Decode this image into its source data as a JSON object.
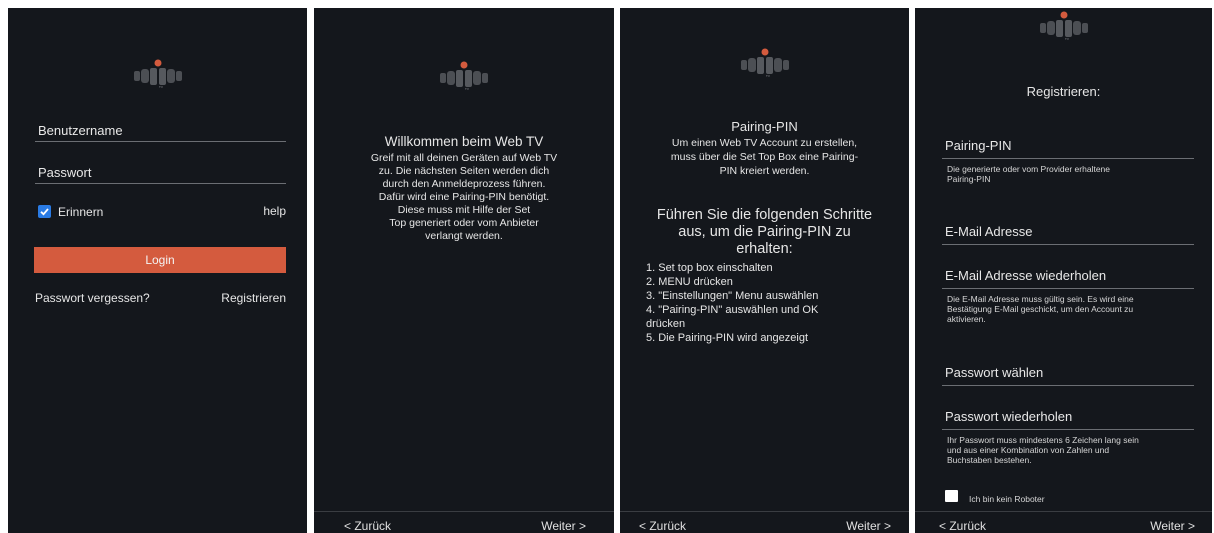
{
  "colors": {
    "panel_bg": "#14171c",
    "accent": "#d45b3e",
    "checkbox": "#2a7be4"
  },
  "login": {
    "username_label": "Benutzername",
    "password_label": "Passwort",
    "remember_label": "Erinnern",
    "remember_checked": true,
    "help_link": "help",
    "login_button": "Login",
    "forgot_link": "Passwort vergessen?",
    "register_link": "Registrieren"
  },
  "welcome": {
    "title": "Willkommen beim Web TV",
    "body_lines": [
      "Greif mit all deinen Geräten auf Web TV",
      "zu. Die nächsten Seiten werden dich",
      "durch den Anmeldeprozess führen.",
      "Dafür wird eine Pairing-PIN benötigt.",
      "Diese muss mit Hilfe der Set",
      "Top generiert oder vom Anbieter",
      "verlangt werden."
    ],
    "back": "< Zurück",
    "next": "Weiter >"
  },
  "pairing": {
    "title": "Pairing-PIN",
    "intro_lines": [
      "Um einen Web TV Account zu erstellen,",
      "muss über die Set Top Box eine Pairing-",
      "PIN kreiert werden."
    ],
    "steps_heading_lines": [
      "Führen Sie die folgenden Schritte",
      "aus, um die Pairing-PIN zu",
      "erhalten:"
    ],
    "steps": [
      "1. Set top box einschalten",
      "2. MENU drücken",
      "3. \"Einstellungen\" Menu auswählen",
      "4. \"Pairing-PIN\" auswählen und OK",
      "drücken",
      "5. Die Pairing-PIN wird angezeigt"
    ],
    "back": "< Zurück",
    "next": "Weiter >"
  },
  "register": {
    "title": "Registrieren:",
    "pin_label": "Pairing-PIN",
    "pin_hint_lines": [
      "Die generierte oder vom Provider erhaltene",
      "Pairing-PIN"
    ],
    "email_label": "E-Mail Adresse",
    "email_repeat_label": "E-Mail Adresse wiederholen",
    "email_hint_lines": [
      "Die E-Mail Adresse muss gültig sein. Es wird eine",
      "Bestätigung E-Mail geschickt, um den Account zu",
      "aktivieren."
    ],
    "password_label": "Passwort wählen",
    "password_repeat_label": "Passwort wiederholen",
    "password_hint_lines": [
      "Ihr Passwort muss mindestens 6 Zeichen lang sein",
      "und aus einer Kombination von Zahlen und",
      "Buchstaben bestehen."
    ],
    "robot_label": "Ich bin kein Roboter",
    "back": "< Zurück",
    "next": "Weiter >"
  }
}
